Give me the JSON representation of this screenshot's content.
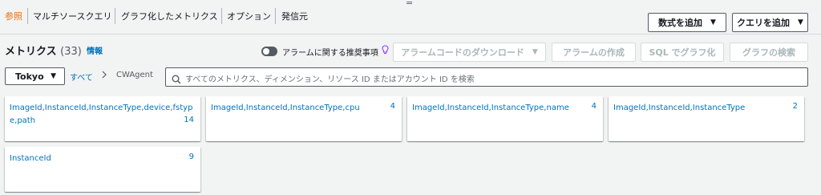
{
  "tabs": [
    {
      "label": "参照",
      "active": true
    },
    {
      "label": "マルチソースクエリ",
      "active": false
    },
    {
      "label": "グラフ化したメトリクス",
      "active": false
    },
    {
      "label": "オプション",
      "active": false
    },
    {
      "label": "発信元",
      "active": false
    }
  ],
  "drag_handle": "=",
  "header_buttons": {
    "add_math": "数式を追加",
    "add_query": "クエリを追加"
  },
  "metrics": {
    "title": "メトリクス",
    "count": "(33)",
    "info": "情報"
  },
  "alarm_toggle": {
    "label": "アラームに関する推奨事項",
    "enabled": false
  },
  "action_buttons": {
    "download_alarm_code": "アラームコードのダウンロード",
    "create_alarm": "アラームの作成",
    "graph_with_sql": "SQL でグラフ化",
    "graph_search": "グラフの検索"
  },
  "region": "Tokyo",
  "breadcrumb": {
    "all": "すべて",
    "separator": ">",
    "namespace": "CWAgent"
  },
  "search": {
    "placeholder": "すべてのメトリクス、ディメンション、リソース ID またはアカウント ID を検索"
  },
  "dimension_cards": [
    {
      "label": "ImageId,InstanceId,InstanceType,device,fstype,path",
      "count": "14"
    },
    {
      "label": "ImageId,InstanceId,InstanceType,cpu",
      "count": "4"
    },
    {
      "label": "ImageId,InstanceId,InstanceType,name",
      "count": "4"
    },
    {
      "label": "ImageId,InstanceId,InstanceType",
      "count": "2"
    },
    {
      "label": "InstanceId",
      "count": "9"
    }
  ],
  "colors": {
    "accent": "#ec7211",
    "link": "#0073bb",
    "background": "#f2f3f3",
    "card": "#ffffff"
  },
  "icons": {
    "dropdown": "caret-down-icon",
    "search": "search-icon",
    "lightbulb": "lightbulb-icon"
  }
}
